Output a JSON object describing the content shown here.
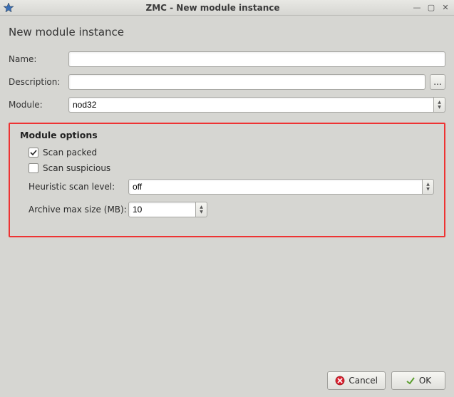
{
  "window": {
    "title": "ZMC - New module instance"
  },
  "page_title": "New module instance",
  "form": {
    "name_label": "Name:",
    "name_value": "",
    "description_label": "Description:",
    "description_value": "",
    "description_more": "...",
    "module_label": "Module:",
    "module_value": "nod32"
  },
  "options": {
    "group_title": "Module options",
    "scan_packed_label": "Scan packed",
    "scan_packed_checked": true,
    "scan_suspicious_label": "Scan suspicious",
    "scan_suspicious_checked": false,
    "heuristic_label": "Heuristic scan level:",
    "heuristic_value": "off",
    "archive_label": "Archive max size (MB):",
    "archive_value": "10"
  },
  "buttons": {
    "cancel": "Cancel",
    "ok": "OK"
  }
}
